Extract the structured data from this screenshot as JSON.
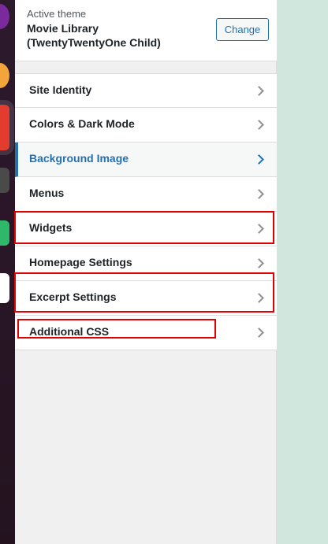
{
  "theme": {
    "active_label": "Active theme",
    "name": "Movie Library (TwentyTwentyOne Child)",
    "change_label": "Change"
  },
  "menu": [
    {
      "label": "Site Identity"
    },
    {
      "label": "Colors & Dark Mode"
    },
    {
      "label": "Background Image",
      "active": true
    },
    {
      "label": "Menus"
    },
    {
      "label": "Widgets",
      "highlighted": true
    },
    {
      "label": "Homepage Settings"
    },
    {
      "label": "Excerpt Settings",
      "highlighted": true
    },
    {
      "label": "Additional CSS",
      "highlighted": true
    }
  ],
  "colors": {
    "accent": "#2271b1",
    "highlight": "#e00000",
    "background_right": "#cfe7dd"
  },
  "dock_icons": [
    "app-icon-purple",
    "app-icon-yellow",
    "app-icon-red",
    "app-icon-gray",
    "app-icon-green",
    "app-icon-white"
  ]
}
